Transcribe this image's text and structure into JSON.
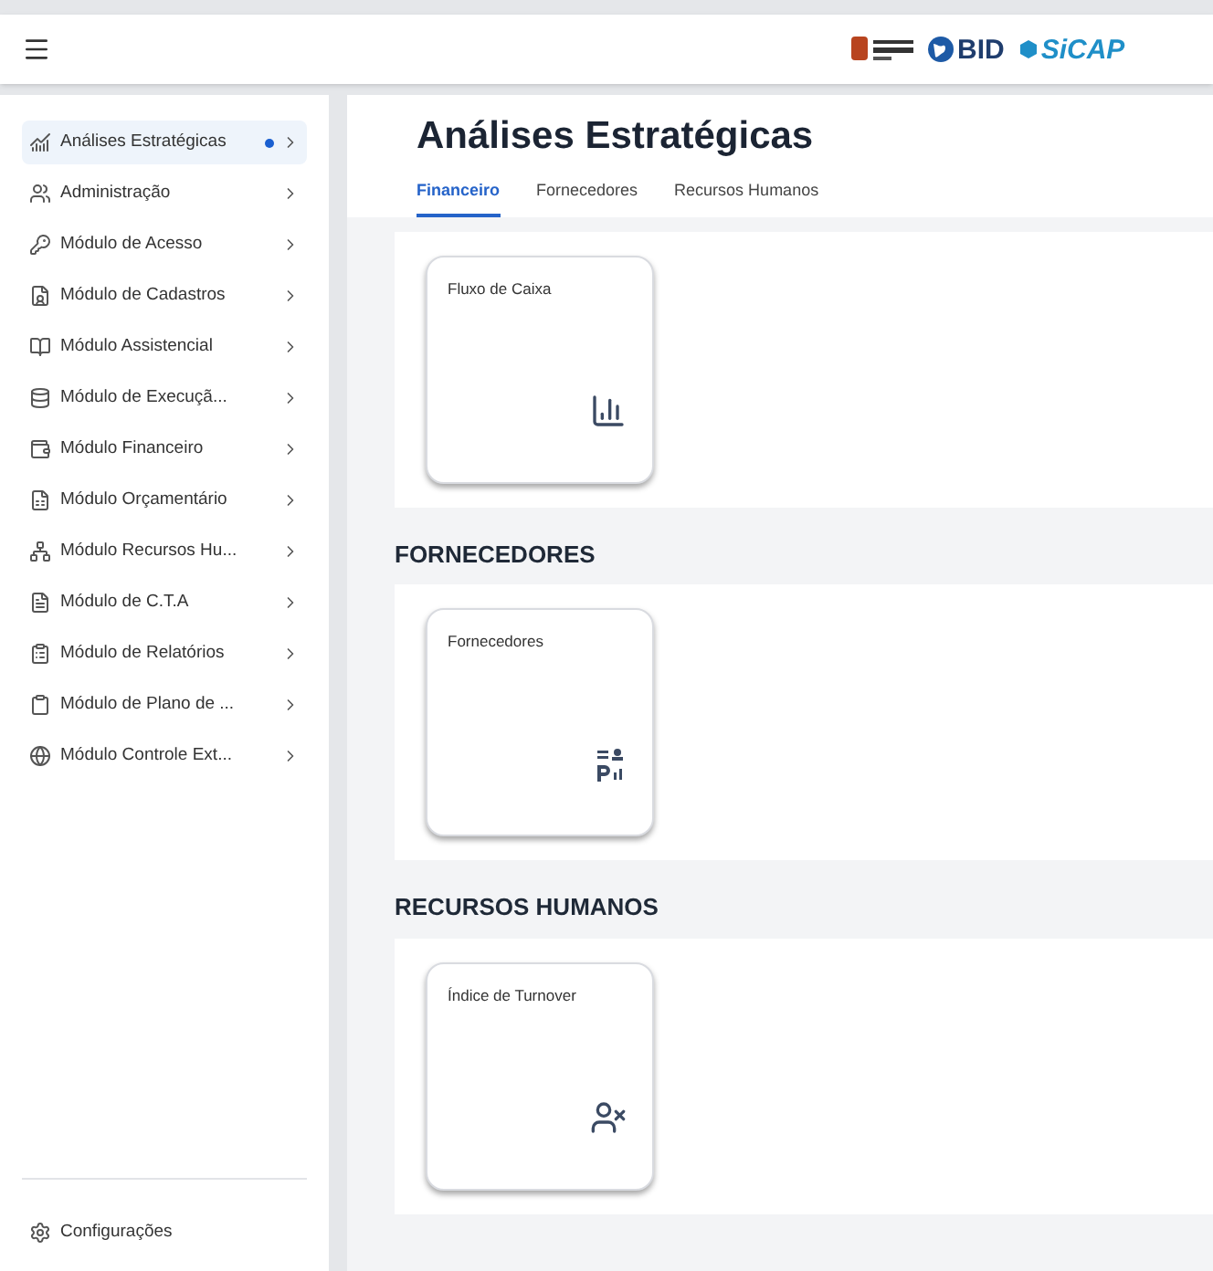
{
  "header": {
    "logos": [
      "BID",
      "SiCAP"
    ]
  },
  "sidebar": {
    "items": [
      {
        "label": "Análises Estratégicas",
        "selected": true,
        "indicator": true
      },
      {
        "label": "Administração",
        "selected": false,
        "indicator": false
      },
      {
        "label": "Módulo de Acesso",
        "selected": false,
        "indicator": false
      },
      {
        "label": "Módulo de Cadastros",
        "selected": false,
        "indicator": false
      },
      {
        "label": "Módulo Assistencial",
        "selected": false,
        "indicator": false
      },
      {
        "label": "Módulo de Execuçã...",
        "selected": false,
        "indicator": false
      },
      {
        "label": "Módulo Financeiro",
        "selected": false,
        "indicator": false
      },
      {
        "label": "Módulo Orçamentário",
        "selected": false,
        "indicator": false
      },
      {
        "label": "Módulo Recursos Hu...",
        "selected": false,
        "indicator": false
      },
      {
        "label": "Módulo de C.T.A",
        "selected": false,
        "indicator": false
      },
      {
        "label": "Módulo de Relatórios",
        "selected": false,
        "indicator": false
      },
      {
        "label": "Módulo de Plano de ...",
        "selected": false,
        "indicator": false
      },
      {
        "label": "Módulo Controle Ext...",
        "selected": false,
        "indicator": false
      }
    ],
    "footer": "Configurações"
  },
  "page": {
    "title": "Análises Estratégicas",
    "tabs": [
      {
        "label": "Financeiro",
        "selected": true
      },
      {
        "label": "Fornecedores",
        "selected": false
      },
      {
        "label": "Recursos Humanos",
        "selected": false
      }
    ],
    "sections": [
      {
        "tiles": [
          {
            "title": "Fluxo de Caixa",
            "kind": "chart"
          }
        ]
      },
      {
        "heading": "FORNECEDORES",
        "tiles": [
          {
            "title": "Fornecedores",
            "kind": "suppliers"
          }
        ]
      },
      {
        "heading": "RECURSOS HUMANOS",
        "tiles": [
          {
            "title": "Índice de Turnover",
            "kind": "person"
          }
        ]
      }
    ]
  }
}
